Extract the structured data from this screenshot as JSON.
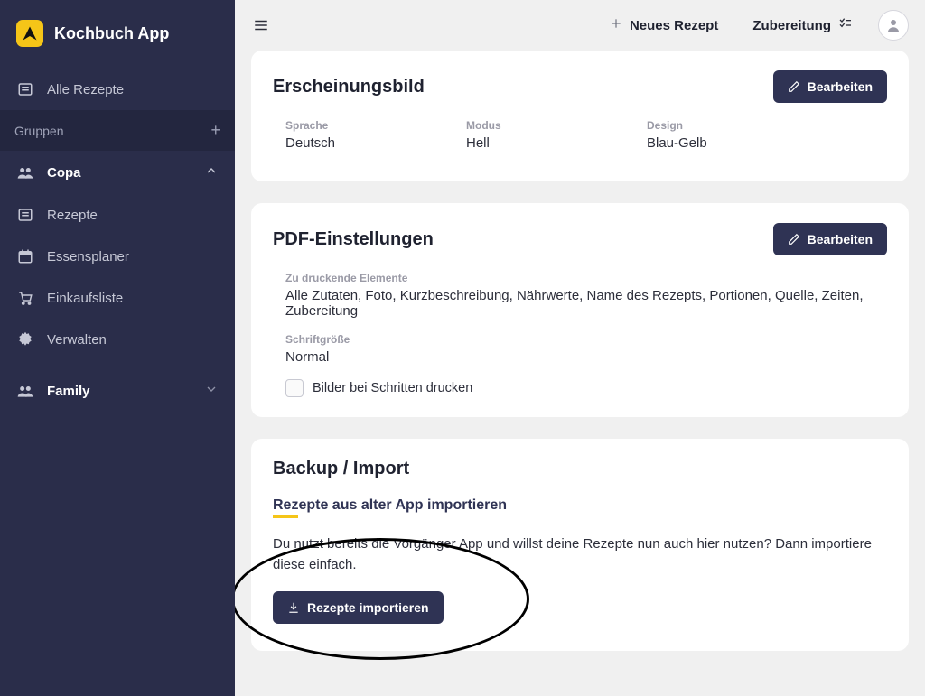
{
  "brand": {
    "name": "Kochbuch App"
  },
  "sidebar": {
    "all_recipes": "Alle Rezepte",
    "groups_header": "Gruppen",
    "group_copa": "Copa",
    "items": {
      "recipes": "Rezepte",
      "planner": "Essensplaner",
      "shopping": "Einkaufsliste",
      "manage": "Verwalten"
    },
    "group_family": "Family"
  },
  "topbar": {
    "new_recipe": "Neues Rezept",
    "preparation": "Zubereitung"
  },
  "appearance": {
    "title": "Erscheinungsbild",
    "edit": "Bearbeiten",
    "language_label": "Sprache",
    "language_value": "Deutsch",
    "mode_label": "Modus",
    "mode_value": "Hell",
    "design_label": "Design",
    "design_value": "Blau-Gelb"
  },
  "pdf": {
    "title": "PDF-Einstellungen",
    "edit": "Bearbeiten",
    "elements_label": "Zu druckende Elemente",
    "elements_value": "Alle Zutaten, Foto, Kurzbeschreibung, Nährwerte, Name des Rezepts, Portionen, Quelle, Zeiten, Zubereitung",
    "fontsize_label": "Schriftgröße",
    "fontsize_value": "Normal",
    "print_images": "Bilder bei Schritten drucken"
  },
  "backup": {
    "title": "Backup / Import",
    "subheading": "Rezepte aus alter App importieren",
    "body": "Du nutzt bereits die Vorgänger App und willst deine Rezepte nun auch hier nutzen? Dann importiere diese einfach.",
    "import_button": "Rezepte importieren"
  }
}
